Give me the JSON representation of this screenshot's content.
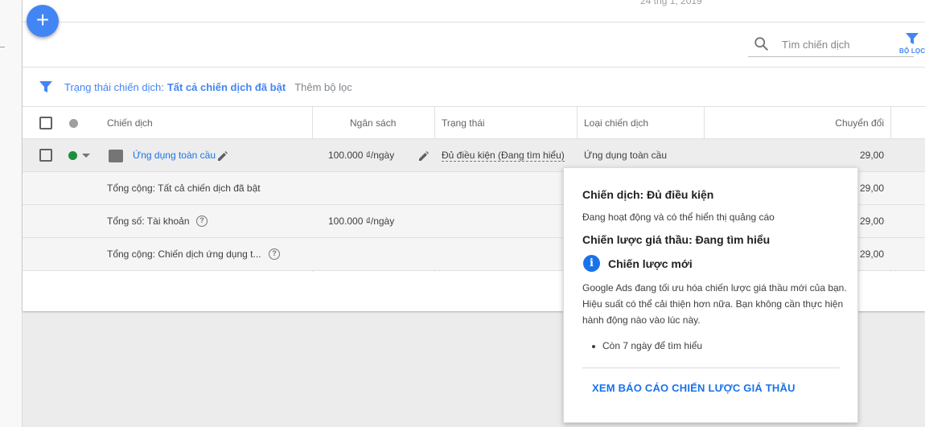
{
  "header": {
    "date_text": "24 thg 1, 2019",
    "fab_label": "+"
  },
  "search": {
    "placeholder": "Tìm chiến dịch",
    "icon": "search-icon"
  },
  "filter_button": {
    "label": "BỘ LỌC",
    "icon": "filter-icon"
  },
  "filter_bar": {
    "label": "Trạng thái chiến dịch:",
    "value": "Tất cả chiến dịch đã bật",
    "add_filter": "Thêm bộ lọc"
  },
  "table": {
    "columns": {
      "campaign": "Chiến dịch",
      "budget": "Ngân sách",
      "status": "Trạng thái",
      "type": "Loại chiến dịch",
      "conversions": "Chuyển đổi"
    },
    "rows": [
      {
        "campaign": "Ứng dụng toàn cầu",
        "budget": "100.000 ₫/ngày",
        "status": "Đủ điều kiện (Đang tìm hiểu)",
        "type": "Ứng dụng toàn cầu",
        "conversions": "29,00"
      }
    ],
    "totals": [
      {
        "label": "Tổng cộng: Tất cả chiến dịch đã bật",
        "budget": "",
        "conversions": "29,00"
      },
      {
        "label": "Tổng số: Tài khoản",
        "budget": "100.000 ₫/ngày",
        "conversions": "29,00"
      },
      {
        "label": "Tổng cộng: Chiến dịch ứng dụng t...",
        "budget": "",
        "conversions": "29,00"
      }
    ]
  },
  "popup": {
    "title": "Chiến dịch: Đủ điều kiện",
    "subtitle": "Đang hoạt động và có thể hiển thị quảng cáo",
    "strategy_title": "Chiến lược giá thầu: Đang tìm hiểu",
    "info_icon": "i",
    "new_strategy": "Chiến lược mới",
    "body": "Google Ads đang tối ưu hóa chiến lược giá thầu mới của bạn. Hiệu suất có thể cải thiện hơn nữa. Bạn không cần thực hiện hành động nào vào lúc này.",
    "bullet": "Còn 7 ngày để tìm hiểu",
    "cta": "XEM BÁO CÁO CHIẾN LƯỢC GIÁ THẦU"
  },
  "colors": {
    "accent": "#4285f4",
    "link": "#1a73e8",
    "enabled_dot": "#1e8e3e"
  }
}
